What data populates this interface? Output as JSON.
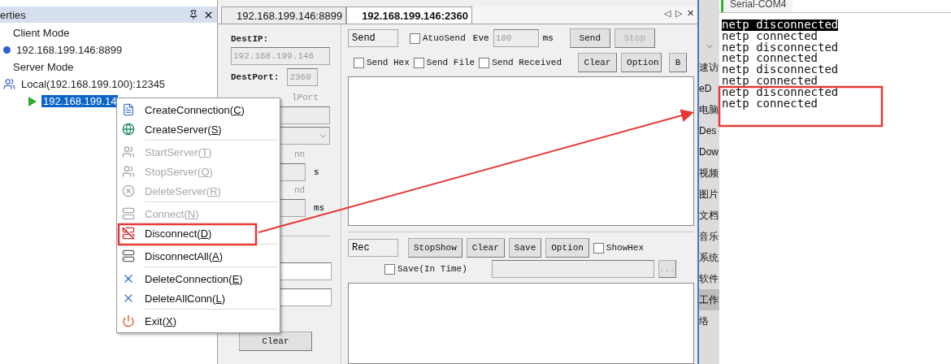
{
  "tree_panel": {
    "title": "erties",
    "items": [
      {
        "kind": "group",
        "label": "Client Mode"
      },
      {
        "kind": "client",
        "label": "192.168.199.146:8899"
      },
      {
        "kind": "group",
        "label": "Server Mode"
      },
      {
        "kind": "server",
        "label": "Local(192.168.199.100):12345",
        "children": [
          {
            "kind": "connection",
            "label": "192.168.199.14",
            "selected": true
          }
        ]
      }
    ]
  },
  "context_menu": [
    {
      "kind": "item",
      "before": "CreateConnection(",
      "key": "C",
      "after": ")",
      "disabled": false
    },
    {
      "kind": "item",
      "before": "CreateServer(",
      "key": "S",
      "after": ")",
      "disabled": false
    },
    {
      "kind": "separator"
    },
    {
      "kind": "item",
      "before": "StartServer(",
      "key": "T",
      "after": ")",
      "disabled": true
    },
    {
      "kind": "item",
      "before": "StopServer(",
      "key": "O",
      "after": ")",
      "disabled": true
    },
    {
      "kind": "item",
      "before": "DeleteServer(",
      "key": "R",
      "after": ")",
      "disabled": true
    },
    {
      "kind": "separator"
    },
    {
      "kind": "item",
      "before": "Connect(",
      "key": "N",
      "after": ")",
      "disabled": true
    },
    {
      "kind": "item",
      "before": "Disconnect(",
      "key": "D",
      "after": ")",
      "disabled": false
    },
    {
      "kind": "separator"
    },
    {
      "kind": "item",
      "before": "DisconnectAll(",
      "key": "A",
      "after": ")",
      "disabled": false
    },
    {
      "kind": "separator"
    },
    {
      "kind": "item",
      "before": "DeleteConnection(",
      "key": "E",
      "after": ")",
      "disabled": false
    },
    {
      "kind": "item",
      "before": "DeleteAllConn(",
      "key": "L",
      "after": ")",
      "disabled": false
    },
    {
      "kind": "separator"
    },
    {
      "kind": "item",
      "before": "Exit(",
      "key": "X",
      "after": ")",
      "disabled": false
    }
  ],
  "tabs": [
    {
      "label": "192.168.199.146:8899",
      "selected": false
    },
    {
      "label": "192.168.199.146:2360",
      "selected": true
    }
  ],
  "tab_nav": [
    "◁",
    "▷",
    "✕"
  ],
  "settings": {
    "dest_ip_label": "DestIP:",
    "dest_ip": "192.168.199.146",
    "dest_port_label": "DestPort:",
    "dest_port": "2360",
    "local_port_fragment": "lPort",
    "conn_fragment": "nn",
    "conn_unit": "s",
    "send_fragment": "nd",
    "send_unit": "ms",
    "clear": "Clear"
  },
  "send": {
    "label": "Send",
    "auto_send": {
      "label": "AtuoSend",
      "checked": false
    },
    "every_label": "Eve",
    "interval": "100",
    "interval_unit": "ms",
    "send_button": "Send",
    "stop_button": "Stop",
    "options": [
      {
        "label": "Send Hex",
        "checked": false
      },
      {
        "label": "Send File",
        "checked": false
      },
      {
        "label": "Send Received",
        "checked": false
      }
    ],
    "clear_button": "Clear",
    "option_button": "Option",
    "cut_button": "B"
  },
  "receive": {
    "label": "Rec",
    "buttons": [
      "StopShow",
      "Clear",
      "Save",
      "Option"
    ],
    "show_hex": {
      "label": "ShowHex",
      "checked": false
    },
    "save_in_time": {
      "label": "Save(In Time)",
      "checked": false
    },
    "browse_button": "..."
  },
  "explorer_strip": {
    "items": [
      {
        "label": "速访",
        "selected": false
      },
      {
        "label": "eD",
        "selected": false
      },
      {
        "label": "电脑",
        "selected": false
      },
      {
        "label": "Des",
        "selected": false
      },
      {
        "label": "Dow",
        "selected": false
      },
      {
        "label": "视频",
        "selected": false
      },
      {
        "label": "图片",
        "selected": false
      },
      {
        "label": "文档",
        "selected": false
      },
      {
        "label": "音乐",
        "selected": false
      },
      {
        "label": "系统",
        "selected": false
      },
      {
        "label": "软件",
        "selected": false
      },
      {
        "label": "工作",
        "selected": true
      },
      {
        "label": "络",
        "selected": false
      }
    ]
  },
  "terminal": {
    "tab": "Serial-COM4",
    "lines": [
      {
        "text": "netp disconnected",
        "selected": true
      },
      {
        "text": "netp connected",
        "selected": false
      },
      {
        "text": "netp disconnected",
        "selected": false
      },
      {
        "text": "netp connected",
        "selected": false
      },
      {
        "text": "netp disconnected",
        "selected": false
      },
      {
        "text": "netp connected",
        "selected": false
      },
      {
        "text": "netp disconnected",
        "selected": false
      },
      {
        "text": "netp connected",
        "selected": false
      }
    ]
  }
}
